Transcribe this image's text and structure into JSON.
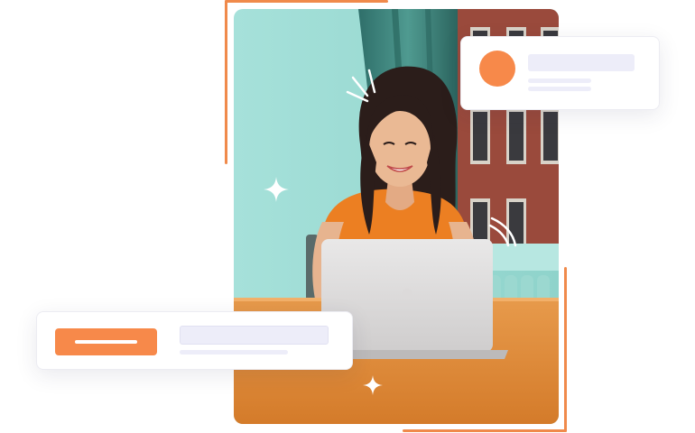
{
  "colors": {
    "accent": "#f7894a",
    "frame": "#f08a4b",
    "placeholder": "#ededf9",
    "wall": "#9fdcd5"
  },
  "photo": {
    "subject": "woman-with-laptop"
  },
  "icons": {
    "sparkles": [
      "sparkle-icon",
      "sparkle-icon"
    ],
    "burst": "burst-lines-icon",
    "signal": "signal-icon"
  }
}
